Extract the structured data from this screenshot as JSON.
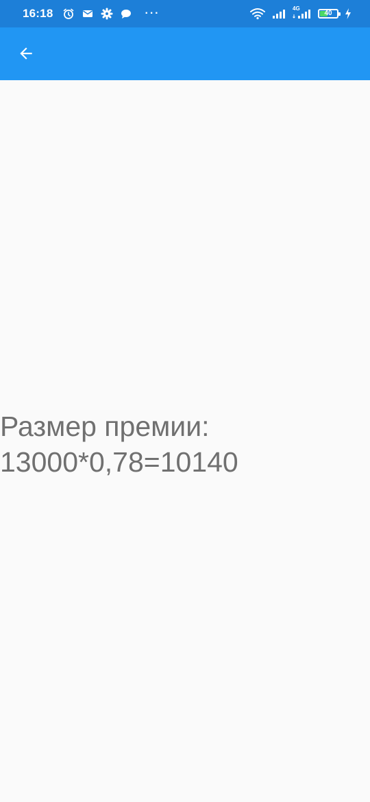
{
  "status_bar": {
    "time": "16:18",
    "left_icons": [
      "alarm-icon",
      "mail-icon",
      "settings-icon",
      "chat-icon"
    ],
    "more": "···",
    "network_label": "4G",
    "battery_level": "40",
    "colors": {
      "background": "#1d7fd8",
      "battery_fill": "#4cd964"
    }
  },
  "app_bar": {
    "back_icon": "arrow-back-icon",
    "color": "#2196f3"
  },
  "main": {
    "result_line1": "Размер премии:",
    "result_line2": "13000*0,78=10140"
  }
}
